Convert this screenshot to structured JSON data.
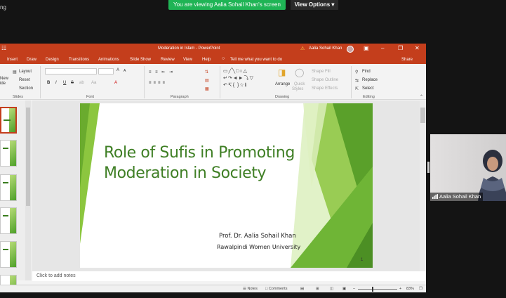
{
  "meeting": {
    "topleft_text": "ng",
    "banner_text": "You are viewing Aalia Sohail Khan's screen",
    "view_options_label": "View Options"
  },
  "powerpoint": {
    "window_title": "Moderation in Islam  -  PowerPoint",
    "user_name": "Aalia Sohail Khan",
    "user_initials": "AS",
    "tabs": [
      "Insert",
      "Draw",
      "Design",
      "Transitions",
      "Animations",
      "Slide Show",
      "Review",
      "View",
      "Help"
    ],
    "tell_me": "Tell me what you want to do",
    "share_label": "Share",
    "ribbon": {
      "slides": {
        "new_label": "New",
        "new_sub": "ide",
        "layout": "Layout",
        "reset": "Reset",
        "section": "Section",
        "group": "Slides"
      },
      "font": {
        "group": "Font",
        "bold": "B",
        "italic": "I",
        "underline": "U",
        "strike": "S",
        "grow": "A",
        "shrink": "A"
      },
      "paragraph": {
        "group": "Paragraph"
      },
      "drawing": {
        "arrange": "Arrange",
        "quick_styles": "Quick",
        "quick_styles_2": "Styles",
        "shape_fill": "Shape Fill",
        "shape_outline": "Shape Outline",
        "shape_effects": "Shape Effects",
        "group": "Drawing"
      },
      "editing": {
        "find": "Find",
        "replace": "Replace",
        "select": "Select",
        "group": "Editing"
      }
    },
    "slide": {
      "title_line1": "Role of Sufis in Promoting",
      "title_line2": "Moderation in Society",
      "author": "Prof. Dr. Aalia Sohail Khan",
      "institution": "Rawalpindi Women University",
      "number": "1"
    },
    "notes_placeholder": "Click to add notes",
    "status": {
      "notes": "Notes",
      "comments": "Comments",
      "zoom": "83%"
    }
  },
  "video": {
    "participant_name": "Aalia Sohail Khan"
  },
  "colors": {
    "ppt_accent": "#c43e1c",
    "slide_green": "#3f7f25",
    "zoom_green": "#1fb455"
  }
}
